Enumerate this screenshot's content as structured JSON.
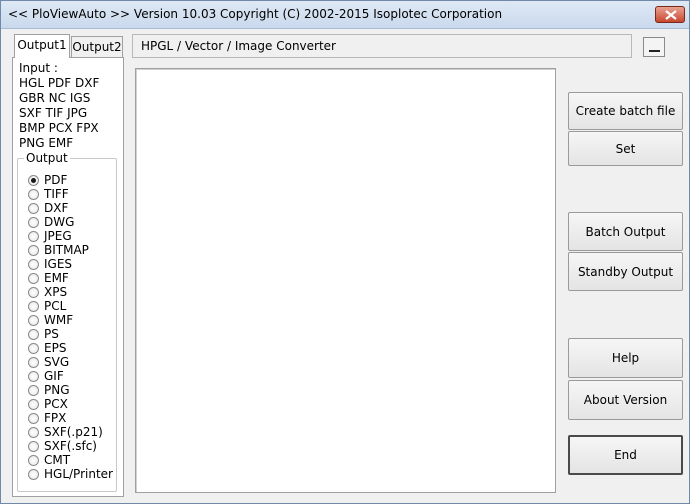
{
  "window": {
    "title": "<< PloViewAuto >>  Version 10.03 Copyright (C) 2002-2015 Isoplotec Corporation"
  },
  "tabs": [
    {
      "label": "Output1",
      "active": true
    },
    {
      "label": "Output2",
      "active": false
    }
  ],
  "input_section": {
    "label": "Input :",
    "lines": [
      "HGL PDF DXF",
      "GBR NC  IGS",
      "SXF TIF JPG",
      "BMP PCX FPX",
      "PNG EMF"
    ]
  },
  "output_group": {
    "label": "Output",
    "selected": "PDF",
    "options": [
      "PDF",
      "TIFF",
      "DXF",
      "DWG",
      "JPEG",
      "BITMAP",
      "IGES",
      "EMF",
      "XPS",
      "PCL",
      "WMF",
      "PS",
      "EPS",
      "SVG",
      "GIF",
      "PNG",
      "PCX",
      "FPX",
      "SXF(.p21)",
      "SXF(.sfc)",
      "CMT",
      "HGL/Printer"
    ]
  },
  "header": {
    "subtitle": "HPGL / Vector / Image Converter"
  },
  "buttons": {
    "create_batch_file": "Create batch file",
    "set": "Set",
    "batch_output": "Batch Output",
    "standby_output": "Standby Output",
    "help": "Help",
    "about_version": "About Version",
    "end": "End"
  },
  "icons": {
    "close": "close-icon",
    "minimize": "minimize-icon"
  }
}
